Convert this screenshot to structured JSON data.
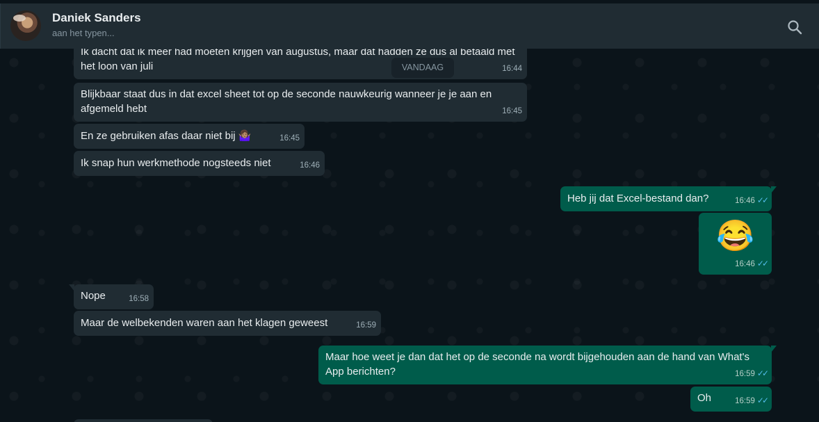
{
  "header": {
    "contact_name": "Daniek Sanders",
    "status": "aan het typen..."
  },
  "day_separator": "VANDAAG",
  "messages": [
    {
      "dir": "in",
      "text": "Ik dacht dat ik meer had moeten krijgen van augustus, maar dat hadden ze dus al betaald met het loon van juli",
      "time": "16:44"
    },
    {
      "dir": "in",
      "text": "Blijkbaar staat dus in dat excel sheet tot op de seconde nauwkeurig wanneer je je aan en afgemeld hebt",
      "time": "16:45"
    },
    {
      "dir": "in",
      "text": "En ze gebruiken afas daar niet bij 🤷🏽‍♀️",
      "time": "16:45"
    },
    {
      "dir": "in",
      "text": "Ik snap hun werkmethode nogsteeds niet",
      "time": "16:46"
    },
    {
      "dir": "out",
      "text": "Heb jij dat Excel-bestand dan?",
      "time": "16:46"
    },
    {
      "dir": "out",
      "text": "😂",
      "time": "16:46"
    },
    {
      "dir": "in",
      "text": "Nope",
      "time": "16:58"
    },
    {
      "dir": "in",
      "text": "Maar de welbekenden waren aan het klagen geweest",
      "time": "16:59"
    },
    {
      "dir": "out",
      "text": "Maar hoe weet je dan dat het op de seconde na wordt bijgehouden aan de hand van What's App berichten?",
      "time": "16:59"
    },
    {
      "dir": "out",
      "text": "Oh",
      "time": "16:59"
    }
  ],
  "colors": {
    "incoming_bubble": "#202c33",
    "outgoing_bubble": "#005c4b",
    "read_ticks": "#53bdeb",
    "background": "#0b141a"
  },
  "icons": {
    "search": "search-icon",
    "read_receipt": "double-check-icon"
  }
}
